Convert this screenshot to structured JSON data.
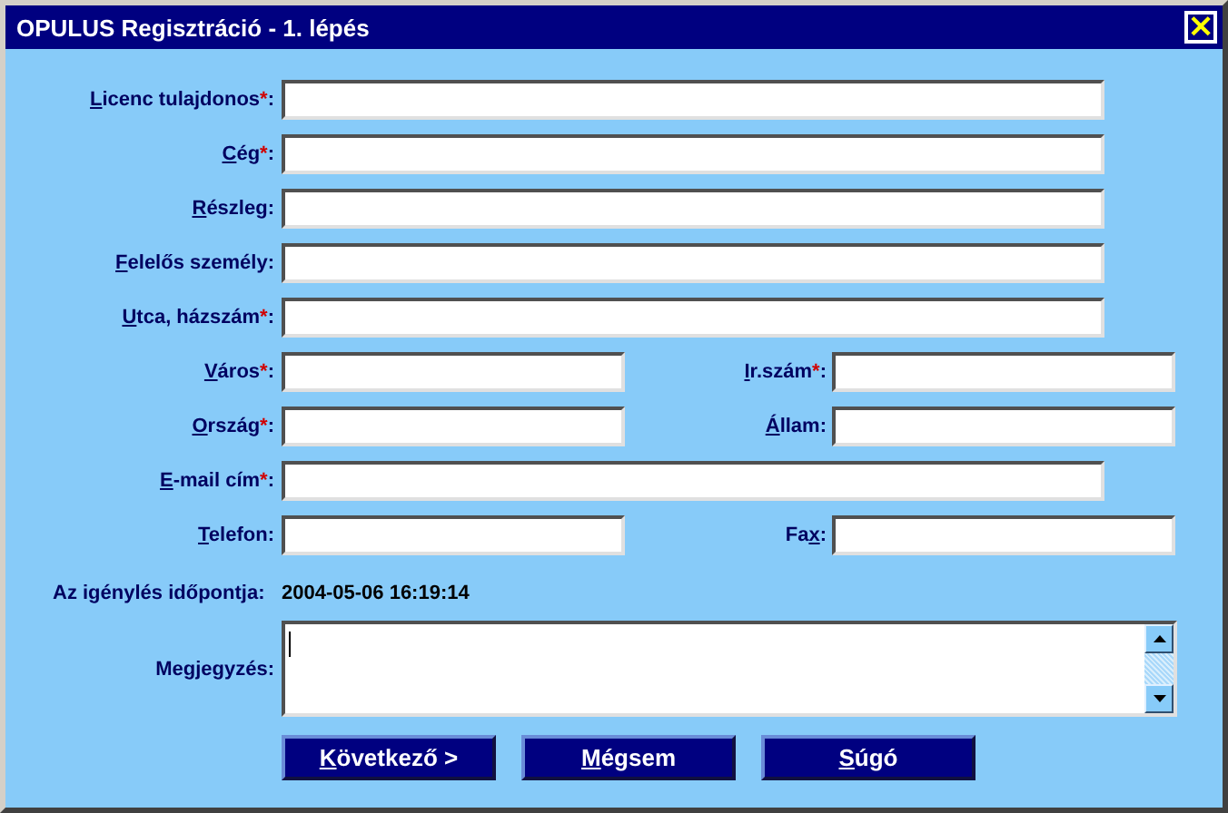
{
  "window": {
    "title": "OPULUS Regisztráció - 1. lépés",
    "close": "×"
  },
  "rows": [
    {
      "kind": "wide",
      "fields": [
        {
          "label": {
            "key": "L",
            "post": "icenc tulajdonos"
          },
          "required_mark": "*",
          "colon": ":"
        }
      ]
    },
    {
      "kind": "wide",
      "fields": [
        {
          "label": {
            "key": "C",
            "post": "ég"
          },
          "required_mark": "*",
          "colon": ":"
        }
      ]
    },
    {
      "kind": "wide",
      "fields": [
        {
          "label": {
            "key": "R",
            "post": "észleg"
          },
          "colon": ":"
        }
      ]
    },
    {
      "kind": "wide",
      "fields": [
        {
          "label": {
            "key": "F",
            "post": "elelős személy"
          },
          "colon": ":"
        }
      ]
    },
    {
      "kind": "wide",
      "fields": [
        {
          "label": {
            "key": "U",
            "post": "tca, házszám"
          },
          "required_mark": "*",
          "colon": ":"
        }
      ]
    },
    {
      "kind": "pair",
      "fields": [
        {
          "label": {
            "key": "V",
            "post": "áros"
          },
          "required_mark": "*",
          "colon": ":"
        },
        {
          "label": {
            "key": "I",
            "post": "r.szám"
          },
          "required_mark": "*",
          "colon": ":"
        }
      ]
    },
    {
      "kind": "pair",
      "fields": [
        {
          "label": {
            "key": "O",
            "post": "rszág"
          },
          "required_mark": "*",
          "colon": ":"
        },
        {
          "label": {
            "key": "Á",
            "post": "llam"
          },
          "colon": ":"
        }
      ]
    },
    {
      "kind": "wide",
      "fields": [
        {
          "label": {
            "key": "E",
            "post": "-mail cím"
          },
          "required_mark": "*",
          "colon": ":"
        }
      ]
    },
    {
      "kind": "pair",
      "fields": [
        {
          "label": {
            "key": "T",
            "post": "elefon"
          },
          "colon": ":"
        },
        {
          "label": {
            "pre": "Fa",
            "key": "x"
          },
          "colon": ":"
        }
      ]
    }
  ],
  "timestamp": {
    "label": "Az igénylés időpontja:",
    "value": "2004-05-06 16:19:14"
  },
  "memo": {
    "label": "Megjegyzés:"
  },
  "buttons": [
    {
      "label": {
        "key": "K",
        "post": "övetkező >"
      }
    },
    {
      "label": {
        "key": "M",
        "post": "égsem"
      }
    },
    {
      "label": {
        "key": "S",
        "post": "úgó"
      }
    }
  ]
}
